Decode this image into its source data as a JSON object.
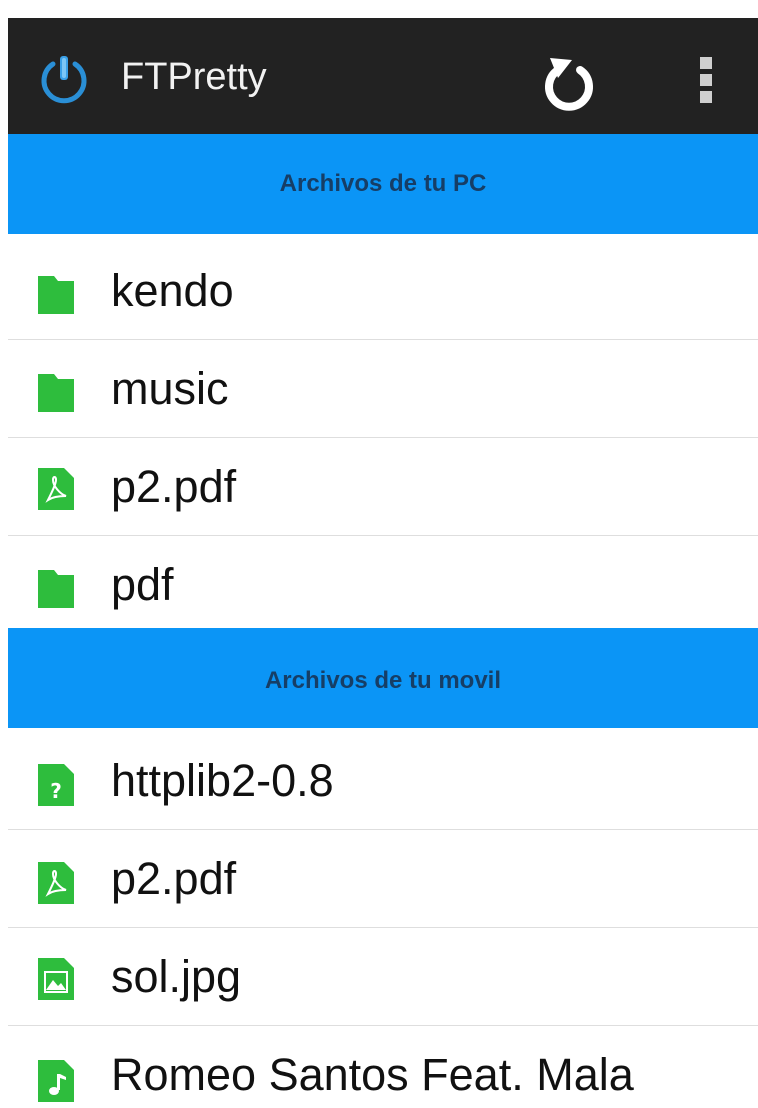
{
  "app": {
    "title": "FTPretty",
    "icons": {
      "logo": "power-icon",
      "refresh": "refresh-icon",
      "menu": "overflow-menu-icon"
    }
  },
  "colors": {
    "actionbar": "#222222",
    "section_header": "#0b95f6",
    "section_text": "#163e66",
    "file_icon": "#2ebd3d"
  },
  "pc_section": {
    "header": "Archivos de tu PC",
    "items": [
      {
        "name": "kendo",
        "icon": "folder-icon"
      },
      {
        "name": "music",
        "icon": "folder-icon"
      },
      {
        "name": "p2.pdf",
        "icon": "pdf-file-icon"
      },
      {
        "name": "pdf",
        "icon": "folder-icon"
      }
    ]
  },
  "mobile_section": {
    "header": "Archivos de tu movil",
    "items": [
      {
        "name": "httplib2-0.8",
        "icon": "unknown-file-icon"
      },
      {
        "name": "p2.pdf",
        "icon": "pdf-file-icon"
      },
      {
        "name": "sol.jpg",
        "icon": "image-file-icon"
      },
      {
        "name": "Romeo Santos Feat. Mala",
        "icon": "music-file-icon"
      }
    ]
  }
}
